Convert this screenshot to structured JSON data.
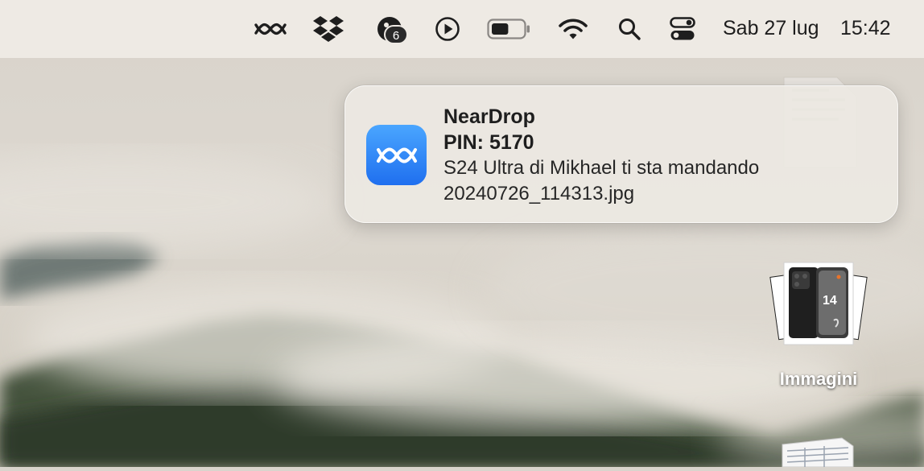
{
  "menubar": {
    "icons": [
      {
        "name": "neardrop-menu-icon"
      },
      {
        "name": "dropbox-icon"
      },
      {
        "name": "notification-app-icon",
        "badge": "6"
      },
      {
        "name": "play-circle-icon"
      },
      {
        "name": "battery-icon",
        "level": 0.55
      },
      {
        "name": "wifi-icon"
      },
      {
        "name": "search-icon"
      },
      {
        "name": "control-center-icon"
      }
    ],
    "date": "Sab 27 lug",
    "time": "15:42"
  },
  "notification": {
    "app_icon": "neardrop-app-icon",
    "title": "NearDrop",
    "pin": "PIN: 5170",
    "body_line1": "S24 Ultra di Mikhael ti sta mandando",
    "body_line2": "20240726_114313.jpg",
    "accent": "#2f7cf6"
  },
  "desktop": {
    "items": [
      {
        "label": "Immagini",
        "icon": "image-stack-icon"
      }
    ]
  }
}
